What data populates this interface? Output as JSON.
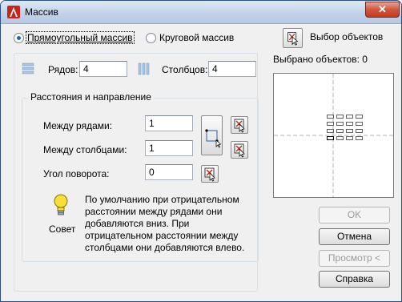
{
  "window": {
    "title": "Массив",
    "close": "✕"
  },
  "type": {
    "rect": {
      "label": "Прямоугольный массив",
      "selected": true
    },
    "polar": {
      "label": "Круговой массив",
      "selected": false
    }
  },
  "selection": {
    "button_label": "Выбор объектов",
    "count_text": "Выбрано объектов: 0"
  },
  "rows": {
    "label": "Рядов:",
    "value": "4"
  },
  "columns": {
    "label": "Столбцов:",
    "value": "4"
  },
  "offset_group": {
    "title": "Расстояния и направление",
    "row_offset": {
      "label": "Между рядами:",
      "value": "1"
    },
    "column_offset": {
      "label": "Между столбцами:",
      "value": "1"
    },
    "angle": {
      "label": "Угол поворота:",
      "value": "0"
    }
  },
  "tip": {
    "caption": "Совет",
    "text_lines": [
      "По умолчанию при отрицательном",
      "расстоянии между рядами они",
      "добавляются вниз. При",
      "отрицательном расстоянии между",
      "столбцами они добавляются влево."
    ]
  },
  "buttons": {
    "ok": "OK",
    "cancel": "Отмена",
    "preview": "Просмотр <",
    "help": "Справка"
  },
  "icons": {
    "app": "autocad-icon",
    "close": "close-icon",
    "select": "select-objects-icon",
    "rows": "rows-icon",
    "columns": "columns-icon",
    "pick_both": "pick-both-offsets-icon",
    "pick": "pick-icon",
    "tip": "lightbulb-icon"
  }
}
